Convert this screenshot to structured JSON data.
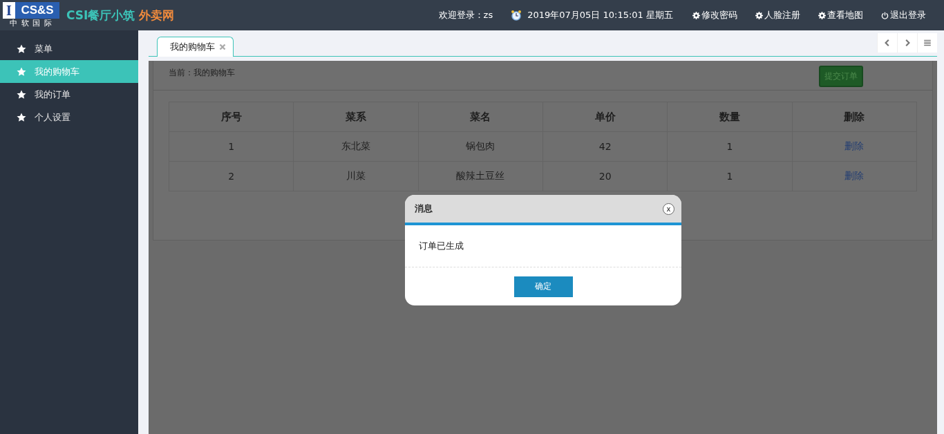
{
  "header": {
    "logo": {
      "mark": "I",
      "brand": "CS&S",
      "subtitle": "中 软 国 际"
    },
    "site_name": "CSI餐厅小筑",
    "site_suffix": "外卖网",
    "welcome": "欢迎登录：zs",
    "datetime": "2019年07月05日 10:15:01 星期五",
    "actions": [
      {
        "label": "修改密码",
        "kind": "gear"
      },
      {
        "label": "人脸注册",
        "kind": "gear"
      },
      {
        "label": "查看地图",
        "kind": "gear"
      },
      {
        "label": "退出登录",
        "kind": "power"
      }
    ]
  },
  "sidebar": {
    "items": [
      {
        "label": "菜单",
        "selected": false
      },
      {
        "label": "我的购物车",
        "selected": true
      },
      {
        "label": "我的订单",
        "selected": false
      },
      {
        "label": "个人设置",
        "selected": false
      }
    ]
  },
  "tabs": [
    {
      "label": "我的购物车",
      "selected": true
    }
  ],
  "breadcrumb": "当前：我的购物车",
  "submit_button": "提交订单",
  "table": {
    "columns": [
      "序号",
      "菜系",
      "菜名",
      "单价",
      "数量",
      "删除"
    ],
    "rows": [
      {
        "cells": [
          "1",
          "东北菜",
          "锅包肉",
          "42",
          "1"
        ],
        "action": "删除"
      },
      {
        "cells": [
          "2",
          "川菜",
          "酸辣土豆丝",
          "20",
          "1"
        ],
        "action": "删除"
      }
    ]
  },
  "dialog": {
    "title": "消息",
    "close": "x",
    "message": "订单已生成",
    "confirm": "确定"
  }
}
